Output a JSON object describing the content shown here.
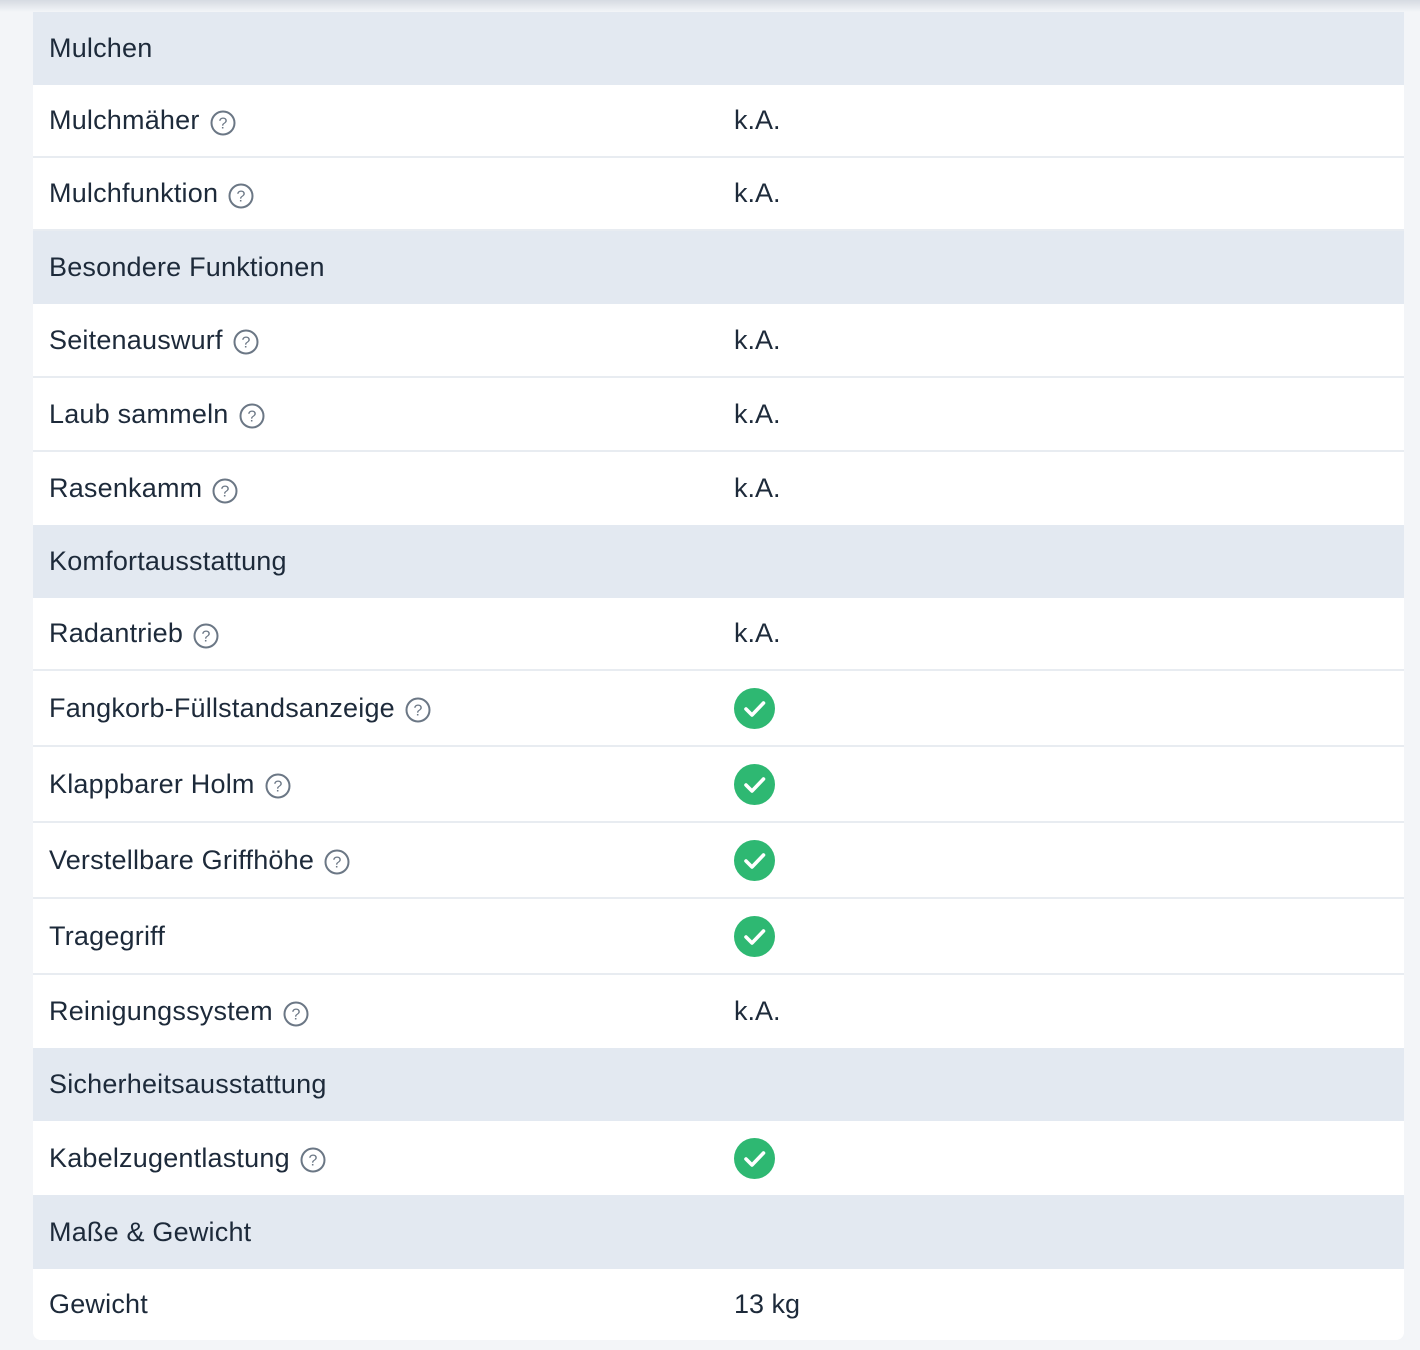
{
  "icons": {
    "help": "help-circle-icon",
    "check": "check-circle-icon"
  },
  "colors": {
    "section_bg": "#e3e9f1",
    "check_green": "#2eb872",
    "text": "#1d2a3a"
  },
  "sections": [
    {
      "title": "Mulchen",
      "rows": [
        {
          "label": "Mulchmäher",
          "value": "k.A."
        },
        {
          "label": "Mulchfunktion",
          "value": "k.A."
        }
      ]
    },
    {
      "title": "Besondere Funktionen",
      "rows": [
        {
          "label": "Seitenauswurf",
          "value": "k.A."
        },
        {
          "label": "Laub sammeln",
          "value": "k.A."
        },
        {
          "label": "Rasenkamm",
          "value": "k.A."
        }
      ]
    },
    {
      "title": "Komfortausstattung",
      "rows": [
        {
          "label": "Radantrieb",
          "value": "k.A."
        },
        {
          "label": "Fangkorb-Füllstandsanzeige",
          "value": ""
        },
        {
          "label": "Klappbarer Holm",
          "value": ""
        },
        {
          "label": "Verstellbare Griffhöhe",
          "value": ""
        },
        {
          "label": "Tragegriff",
          "value": ""
        },
        {
          "label": "Reinigungssystem",
          "value": "k.A."
        }
      ]
    },
    {
      "title": "Sicherheitsausstattung",
      "rows": [
        {
          "label": "Kabelzugentlastung",
          "value": ""
        }
      ]
    },
    {
      "title": "Maße & Gewicht",
      "rows": [
        {
          "label": "Gewicht",
          "value": "13 kg"
        }
      ]
    }
  ]
}
